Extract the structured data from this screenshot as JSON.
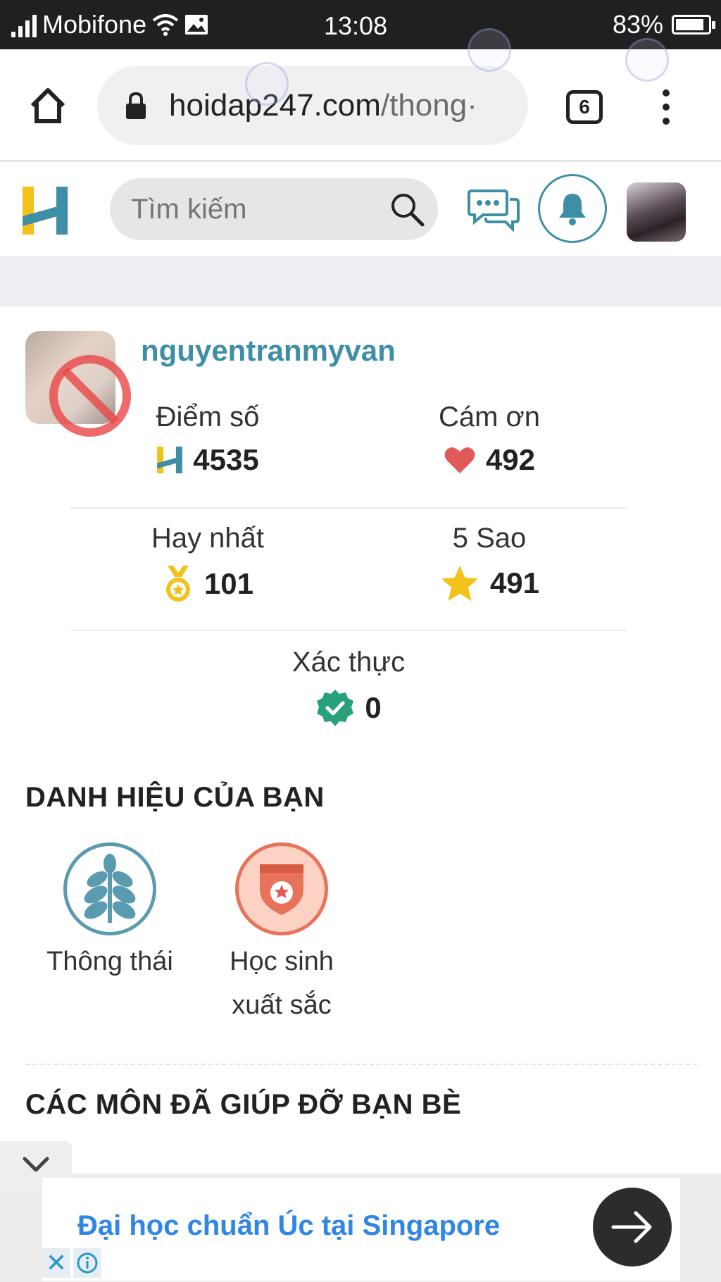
{
  "status_bar": {
    "carrier": "Mobifone",
    "time": "13:08",
    "battery": "83%",
    "battery_level": 0.83
  },
  "browser": {
    "url_domain": "hoidap247.com",
    "url_path": "/thong·",
    "tab_count": "6"
  },
  "site_header": {
    "search_placeholder": "Tìm kiếm"
  },
  "profile": {
    "username": "nguyentranmyvan",
    "stats": {
      "points": {
        "label": "Điểm số",
        "value": "4535"
      },
      "thanks": {
        "label": "Cám ơn",
        "value": "492"
      },
      "best": {
        "label": "Hay nhất",
        "value": "101"
      },
      "five_star": {
        "label": "5 Sao",
        "value": "491"
      },
      "verified": {
        "label": "Xác thực",
        "value": "0"
      }
    }
  },
  "titles_section": {
    "heading": "DANH HIỆU CỦA BẠN",
    "badges": [
      {
        "name": "Thông thái",
        "icon": "wheat-icon",
        "color": "#5b9bb0"
      },
      {
        "name_line1": "Học sinh",
        "name_line2": "xuất sắc",
        "icon": "shield-star-icon",
        "color": "#e8735a"
      }
    ]
  },
  "subjects_section": {
    "heading": "CÁC MÔN ĐÃ GIÚP ĐỠ BẠN BÈ"
  },
  "ad": {
    "text": "Đại học chuẩn Úc tại Singapore",
    "close_glyph": "✕"
  },
  "colors": {
    "accent": "#3e8fa6",
    "logo_yellow": "#f2c21b",
    "heart": "#e05a5a",
    "star": "#f2c21b",
    "verified": "#27a07c",
    "ad_text": "#2f86e4"
  }
}
